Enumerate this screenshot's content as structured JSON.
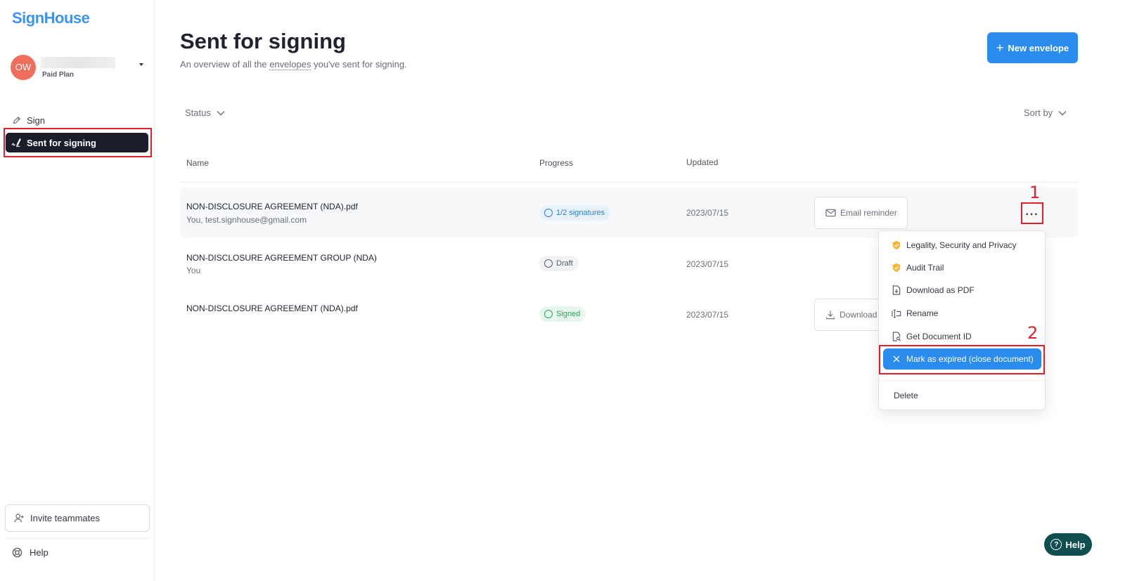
{
  "app": {
    "logo": "SignHouse"
  },
  "account": {
    "initials": "OW",
    "plan": "Paid Plan"
  },
  "sidebar": {
    "items": [
      {
        "label": "Sign",
        "icon": "pen-icon"
      },
      {
        "label": "Sent for signing",
        "icon": "signature-icon",
        "active": true
      }
    ],
    "invite_label": "Invite teammates",
    "help_label": "Help"
  },
  "header": {
    "title": "Sent for signing",
    "subtitle_before": "An overview of all the",
    "subtitle_link": "envelopes",
    "subtitle_after": "you've sent for signing.",
    "new_button": "New envelope"
  },
  "filters": {
    "status_label": "Status",
    "sort_label": "Sort by"
  },
  "table": {
    "columns": [
      "Name",
      "Progress",
      "Updated"
    ],
    "rows": [
      {
        "name": "NON-DISCLOSURE AGREEMENT (NDA).pdf",
        "recipients": "You, test.signhouse@gmail.com",
        "progress": "1/2 signatures",
        "status_color": "#2b7dd6",
        "updated": "2023/07/15",
        "action": "Email reminder"
      },
      {
        "name": "NON-DISCLOSURE AGREEMENT GROUP (NDA)",
        "recipients": "You",
        "progress": "Draft",
        "status_color": "#585c66",
        "updated": "2023/07/15",
        "action": ""
      },
      {
        "name": "NON-DISCLOSURE AGREEMENT (NDA).pdf",
        "recipients": "",
        "progress": "Signed",
        "status_color": "#27a35a",
        "updated": "2023/07/15",
        "action": "Download"
      }
    ]
  },
  "menu": {
    "items": [
      {
        "label": "Legality, Security and Privacy",
        "icon": "shield-check-icon"
      },
      {
        "label": "Audit Trail",
        "icon": "shield-check-icon"
      },
      {
        "label": "Download as PDF",
        "icon": "file-download-icon"
      },
      {
        "label": "Rename",
        "icon": "rename-icon"
      },
      {
        "label": "Get Document ID",
        "icon": "file-search-icon"
      },
      {
        "label": "Mark as expired (close document)",
        "icon": "close-icon",
        "active": true
      },
      {
        "label": "Delete",
        "icon": ""
      }
    ]
  },
  "annotations": {
    "step1": "1",
    "step2": "2"
  },
  "help_widget": {
    "label": "Help"
  },
  "colors": {
    "accent": "#2b8cf0",
    "highlight": "#e0202a",
    "nav_active": "#1b1d2a",
    "help_widget": "#0f4f52",
    "avatar": "#ef6e5c"
  }
}
